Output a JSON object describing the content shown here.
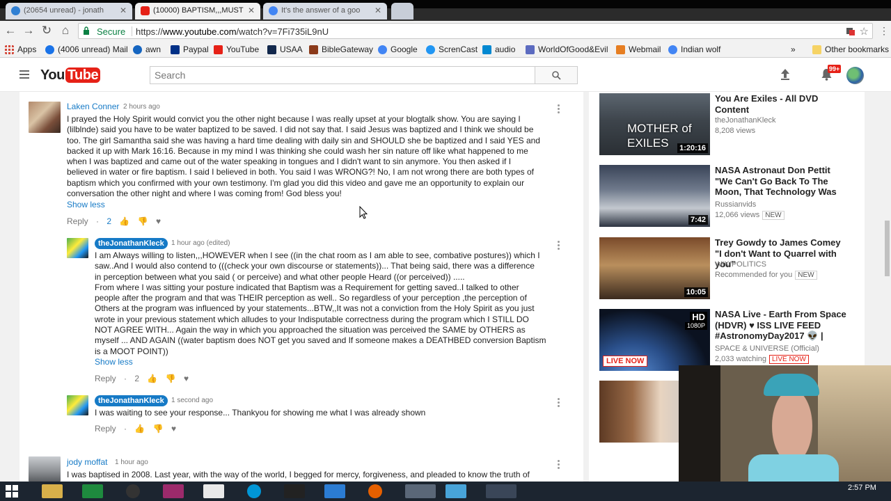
{
  "browser": {
    "tabs": [
      {
        "label": "(20654 unread) - jonath",
        "icon_color": "#2f7fd3"
      },
      {
        "label": "(10000) BAPTISM,,,MUST",
        "icon_color": "#e62117"
      },
      {
        "label": "It's the answer of a goo",
        "icon_color": "#4285f4"
      }
    ],
    "nav": {
      "back": "←",
      "forward": "→",
      "reload": "↻",
      "home": "⌂"
    },
    "omnibox": {
      "secure_label": "Secure",
      "url_scheme": "https://",
      "url_host": "www.youtube.com",
      "url_path": "/watch?v=7Fi735iL9nU"
    },
    "bookmarks": [
      {
        "label": "Apps",
        "icon": "apps-grid-icon",
        "color": "#d44638"
      },
      {
        "label": "(4006 unread) Mail",
        "icon": "mail-icon",
        "color": "#1a73e8"
      },
      {
        "label": "awn",
        "icon": "globe-icon",
        "color": "#1565c0"
      },
      {
        "label": "Paypal",
        "icon": "paypal-icon",
        "color": "#003087"
      },
      {
        "label": "YouTube",
        "icon": "youtube-icon",
        "color": "#e62117"
      },
      {
        "label": "USAA",
        "icon": "usaa-icon",
        "color": "#12284c"
      },
      {
        "label": "BibleGateway",
        "icon": "biblegateway-icon",
        "color": "#8b3a1a"
      },
      {
        "label": "Google",
        "icon": "google-icon",
        "color": "#4285f4"
      },
      {
        "label": "ScrenCast",
        "icon": "screencast-icon",
        "color": "#2196f3"
      },
      {
        "label": "audio",
        "icon": "audio-icon",
        "color": "#0288d1"
      },
      {
        "label": "WorldOfGood&Evil",
        "icon": "planet-icon",
        "color": "#5c6bc0"
      },
      {
        "label": "Webmail",
        "icon": "webmail-icon",
        "color": "#e67e22"
      },
      {
        "label": "Indian wolf",
        "icon": "google-icon",
        "color": "#4285f4"
      }
    ],
    "bookmarks_overflow": "»",
    "other_bookmarks": "Other bookmarks"
  },
  "youtube": {
    "logo_text": "You",
    "logo_tube": "Tube",
    "search_placeholder": "Search",
    "notifications_count": "99+"
  },
  "comments": [
    {
      "author": "Laken Conner",
      "time": "2 hours ago",
      "text_lines": [
        "I prayed the Holy Spirit would convict you the other night because I was really upset at your blogtalk show.  You are saying I",
        "(lilblnde) said you have to be water baptized to be saved.  I did not say that.  I said Jesus was baptized and I think we should be",
        "too. The girl Samantha said she was having a hard time dealing with daily sin and SHOULD she be baptized and I said YES and",
        "backed it up with Mark 16:16.  Because in my mind I was thinking she could wash her sin nature off like what happened to me",
        "when I was baptized and came out of the water speaking in tongues and I didn't want to sin anymore.  You then asked if I",
        "believed in water or fire baptism.  I said I believed in both.  You said I was WRONG?!  No, I am not wrong there are both types of",
        "baptism which you confirmed with your own testimony.  I'm glad you did this video and gave me an opportunity to explain our",
        "conversation the other night and where I was coming from!  God bless you!"
      ],
      "show_less": "Show less",
      "reply_label": "Reply",
      "likes": "2"
    },
    {
      "author": "theJonathanKleck",
      "time": "1 hour ago (edited)",
      "text_lines": [
        "I am Always willing to listen,,,HOWEVER when I see ((in the chat room as I am able to see, combative postures)) which I",
        "saw..And I would also contend to (((check your own discourse or statements))... That being said, there was a difference",
        "in perception between what you said ( or perceive) and what other people Heard ((or perceived)) .....",
        "From where I was sitting your posture indicated that Baptism was a Requirement for getting saved..I talked to other",
        "people after the program and that was THEIR perception as well.. So regardless of your perception ,the perception of",
        "Others at the program was influenced by your statements...BTW,,It was not a conviction from the Holy Spirit as you just",
        "wrote in your previous statement which alludes to your Indisputable correctness during the program which I STILL DO",
        "NOT AGREE WITH... Again the way in which you approached the  situation was perceived the SAME by OTHERS as",
        "myself ... AND AGAIN ((water baptism does NOT get you saved and If someone makes a DEATHBED conversion Baptism",
        "is a MOOT POINT))"
      ],
      "show_less": "Show less",
      "reply_label": "Reply",
      "likes": "2"
    },
    {
      "author": "theJonathanKleck",
      "time": "1 second ago",
      "text_lines": [
        "I was waiting to see your response... Thankyou for showing me what I was already shown"
      ],
      "reply_label": "Reply"
    },
    {
      "author": "jody moffat",
      "time": "1 hour ago",
      "text_lines": [
        "I was baptised in 2008. Last year, with the way of the world, I begged  for mercy, forgiveness, and pleaded to know the truth of"
      ]
    }
  ],
  "related": [
    {
      "title": "You Are Exiles - All DVD Content",
      "channel": "theJonathanKleck",
      "meta": "8,208 views",
      "duration": "1:20:16",
      "thumb_caption": "MOTHER of EXILES"
    },
    {
      "title": "NASA Astronaut Don Pettit \"We Can't Go Back To The Moon, That Technology Was",
      "channel": "Russianvids",
      "meta": "12,066 views",
      "badge": "NEW",
      "duration": "7:42"
    },
    {
      "title": "Trey Gowdy to James Comey \"I don't Want to Quarrel with you\"",
      "channel": "WIKIPOLITICS",
      "meta": "Recommended for you",
      "badge": "NEW",
      "duration": "10:05"
    },
    {
      "title": "NASA Live - Earth From Space (HDVR) ♥ ISS LIVE FEED #AstronomyDay2017 👽 |",
      "channel": "SPACE & UNIVERSE (Official)",
      "meta": "2,033 watching",
      "live_badge": "LIVE NOW",
      "thumb_live": "LIVE NOW",
      "thumb_hd": "HD",
      "thumb_res": "1080P"
    },
    {
      "title": "",
      "channel": "",
      "meta": ""
    }
  ],
  "taskbar": {
    "time": "2:57 PM"
  }
}
